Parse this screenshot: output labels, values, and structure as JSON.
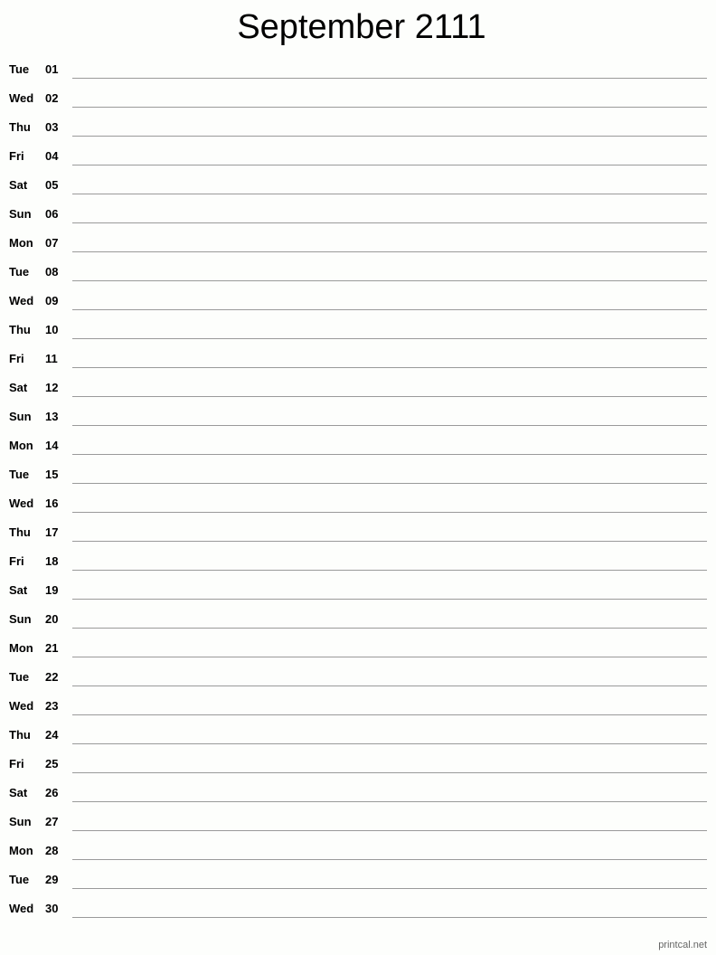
{
  "title": "September 2111",
  "days": [
    {
      "dow": "Tue",
      "day": "01"
    },
    {
      "dow": "Wed",
      "day": "02"
    },
    {
      "dow": "Thu",
      "day": "03"
    },
    {
      "dow": "Fri",
      "day": "04"
    },
    {
      "dow": "Sat",
      "day": "05"
    },
    {
      "dow": "Sun",
      "day": "06"
    },
    {
      "dow": "Mon",
      "day": "07"
    },
    {
      "dow": "Tue",
      "day": "08"
    },
    {
      "dow": "Wed",
      "day": "09"
    },
    {
      "dow": "Thu",
      "day": "10"
    },
    {
      "dow": "Fri",
      "day": "11"
    },
    {
      "dow": "Sat",
      "day": "12"
    },
    {
      "dow": "Sun",
      "day": "13"
    },
    {
      "dow": "Mon",
      "day": "14"
    },
    {
      "dow": "Tue",
      "day": "15"
    },
    {
      "dow": "Wed",
      "day": "16"
    },
    {
      "dow": "Thu",
      "day": "17"
    },
    {
      "dow": "Fri",
      "day": "18"
    },
    {
      "dow": "Sat",
      "day": "19"
    },
    {
      "dow": "Sun",
      "day": "20"
    },
    {
      "dow": "Mon",
      "day": "21"
    },
    {
      "dow": "Tue",
      "day": "22"
    },
    {
      "dow": "Wed",
      "day": "23"
    },
    {
      "dow": "Thu",
      "day": "24"
    },
    {
      "dow": "Fri",
      "day": "25"
    },
    {
      "dow": "Sat",
      "day": "26"
    },
    {
      "dow": "Sun",
      "day": "27"
    },
    {
      "dow": "Mon",
      "day": "28"
    },
    {
      "dow": "Tue",
      "day": "29"
    },
    {
      "dow": "Wed",
      "day": "30"
    }
  ],
  "footer": "printcal.net"
}
